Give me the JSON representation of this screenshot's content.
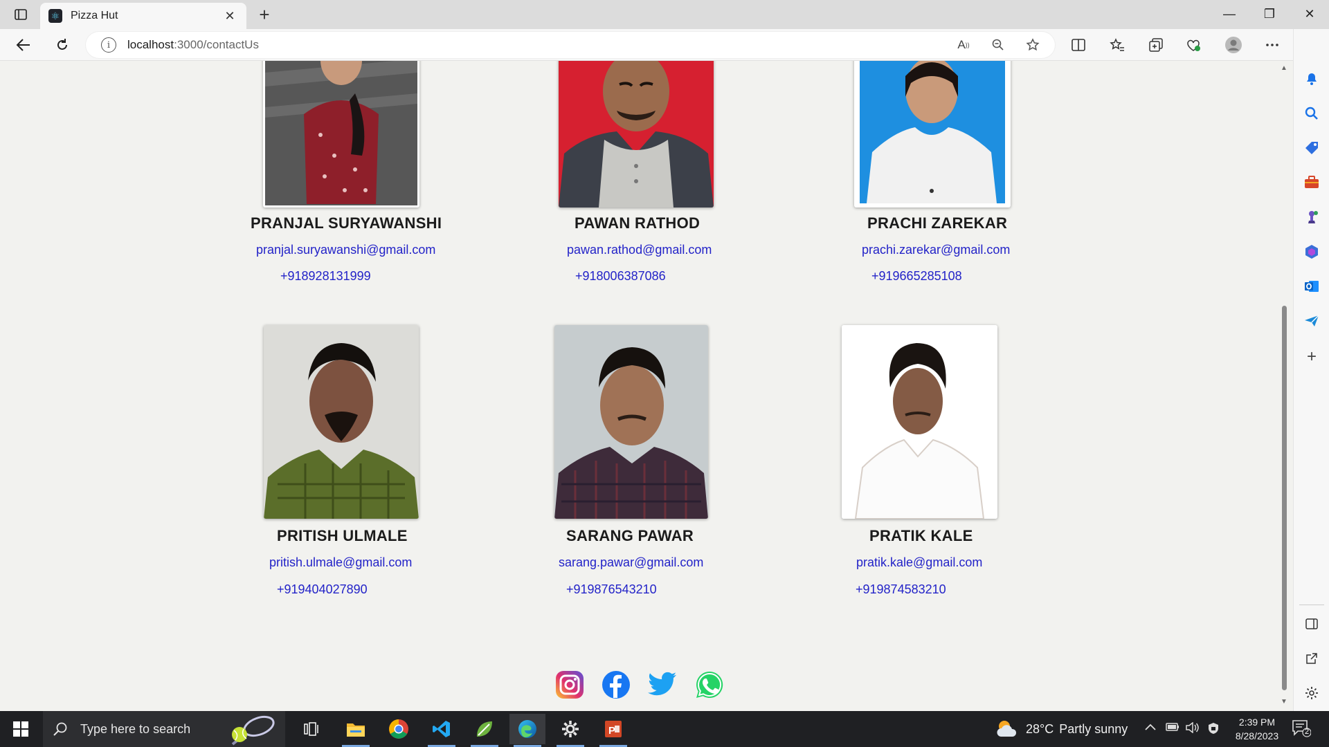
{
  "browser": {
    "tab_title": "Pizza Hut",
    "url_host": "localhost",
    "url_path": ":3000/contactUs",
    "close_tab_glyph": "✕",
    "new_tab_glyph": "+"
  },
  "window_controls": {
    "minimize": "—",
    "restore": "❐",
    "close": "✕"
  },
  "contacts": [
    {
      "name": "PRANJAL SURYAWANSHI",
      "email": "pranjal.suryawanshi@gmail.com",
      "phone": "+918928131999",
      "shirt_color": "#8e1f2a",
      "bg_color": "#575757"
    },
    {
      "name": "PAWAN RATHOD",
      "email": "pawan.rathod@gmail.com",
      "phone": "+918006387086",
      "shirt_color": "#c8c8c4",
      "bg_color": "#d62030"
    },
    {
      "name": "PRACHI ZAREKAR",
      "email": "prachi.zarekar@gmail.com",
      "phone": "+919665285108",
      "shirt_color": "#f1f1f1",
      "bg_color": "#1e8fe0"
    },
    {
      "name": "PRITISH ULMALE",
      "email": "pritish.ulmale@gmail.com",
      "phone": "+919404027890",
      "shirt_color": "#5b6e2a",
      "bg_color": "#dcdcd8"
    },
    {
      "name": "SARANG PAWAR",
      "email": "sarang.pawar@gmail.com",
      "phone": "+919876543210",
      "shirt_color": "#3e2b3a",
      "bg_color": "#c6ccce"
    },
    {
      "name": "PRATIK KALE",
      "email": "pratik.kale@gmail.com",
      "phone": "+919874583210",
      "shirt_color": "#ffffff",
      "bg_color": "#ffffff"
    }
  ],
  "social_links": [
    {
      "name": "instagram",
      "color": "#c1358a"
    },
    {
      "name": "facebook",
      "color": "#1877f2"
    },
    {
      "name": "twitter",
      "color": "#1da1f2"
    },
    {
      "name": "whatsapp",
      "color": "#25d366"
    }
  ],
  "taskbar": {
    "search_placeholder": "Type here to search",
    "weather_temp": "28°C",
    "weather_desc": "Partly sunny",
    "time": "2:39 PM",
    "date": "8/28/2023",
    "notification_count": "2"
  }
}
